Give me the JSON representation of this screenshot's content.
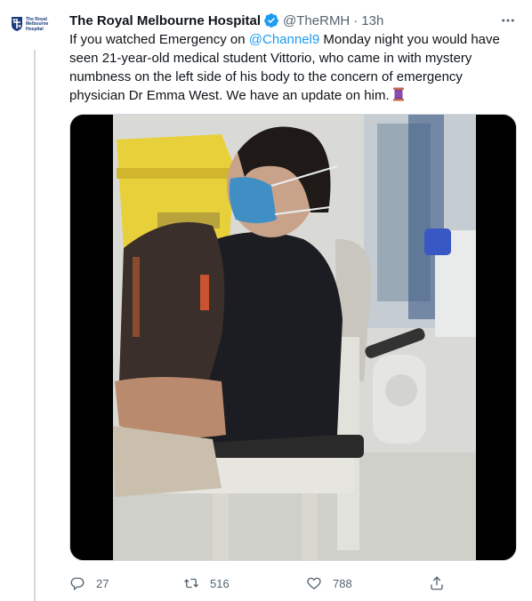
{
  "account": {
    "display_name": "The Royal Melbourne Hospital",
    "handle": "@TheRMH",
    "separator": "·",
    "time": "13h",
    "logo_text_line1": "The Royal",
    "logo_text_line2": "Melbourne",
    "logo_text_line3": "Hospital"
  },
  "tweet": {
    "text_before_mention": "If you watched Emergency on ",
    "mention": "@Channel9",
    "text_after_mention": " Monday night you would have seen 21-year-old medical student Vittorio, who came in with mystery numbness on the left side of his body to the concern of emergency physician Dr Emma West. We have an update on him.",
    "emoji": "spool-of-thread"
  },
  "media": {
    "type": "video-still",
    "description_icon": "video-frame"
  },
  "actions": {
    "reply_count": "27",
    "retweet_count": "516",
    "like_count": "788"
  },
  "colors": {
    "accent": "#1d9bf0",
    "text": "#0f1419",
    "muted": "#536471",
    "brand": "#1b3b7a"
  }
}
